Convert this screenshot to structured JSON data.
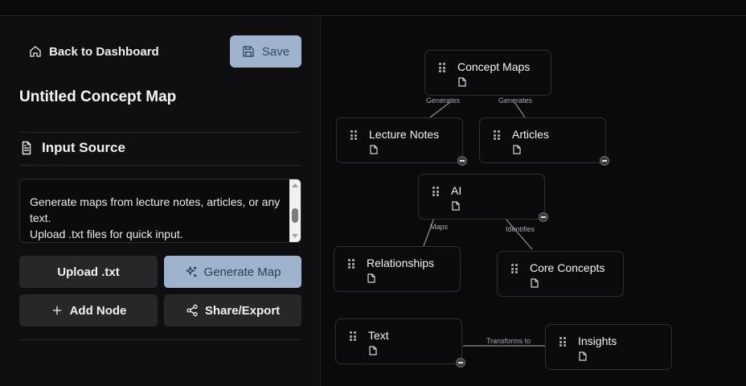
{
  "sidebar": {
    "back_label": "Back to Dashboard",
    "save_label": "Save",
    "map_title": "Untitled Concept Map",
    "input_section_title": "Input Source",
    "input_text": "Generate maps from lecture notes, articles, or any text.\nUpload .txt files for quick input.",
    "buttons": {
      "upload": "Upload .txt",
      "generate": "Generate Map",
      "add_node": "Add Node",
      "share": "Share/Export"
    }
  },
  "canvas": {
    "nodes": {
      "concept_maps": "Concept Maps",
      "lecture_notes": "Lecture Notes",
      "articles": "Articles",
      "ai": "AI",
      "relationships": "Relationships",
      "core_concepts": "Core Concepts",
      "text": "Text",
      "insights": "Insights"
    },
    "edges": {
      "generates_1": "Generates",
      "generates_2": "Generates",
      "maps": "Maps",
      "identifies": "Identifies",
      "transforms_to": "Transforms to"
    }
  },
  "colors": {
    "accent": "#9fb3cc",
    "background": "#0a0a0b",
    "sidebar": "#0f0f11",
    "button_dark": "#27272b"
  },
  "icons": {
    "back": "home-icon",
    "save": "save-icon",
    "section": "document-icon",
    "generate": "sparkles-icon",
    "add": "plus-icon",
    "share": "share-icon",
    "node_drag": "grip-icon",
    "node_doc": "file-icon",
    "node_collapse": "minus-circle-icon"
  }
}
